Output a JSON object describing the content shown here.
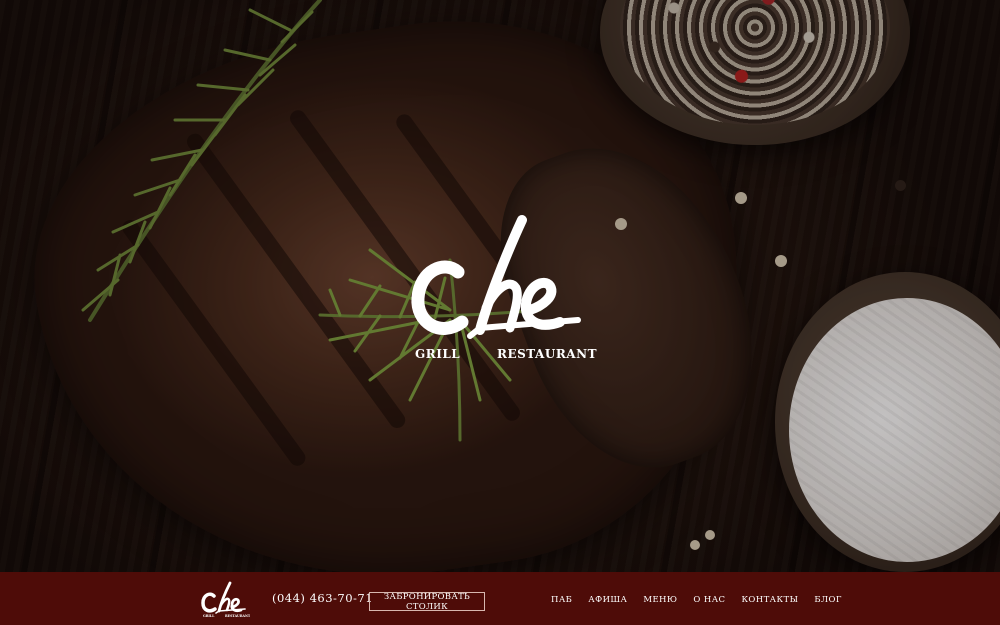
{
  "brand": {
    "logo_word": "Che",
    "sub_left": "GRILL",
    "sub_right": "RESTAURANT",
    "logo_color": "#ffffff"
  },
  "nav": {
    "phone": "(044) 463-70-71",
    "reserve_label": "ЗАБРОНИРОВАТЬ СТОЛИК",
    "items": [
      {
        "label": "ПАБ"
      },
      {
        "label": "АФИША"
      },
      {
        "label": "МЕНЮ"
      },
      {
        "label": "О НАС"
      },
      {
        "label": "КОНТАКТЫ"
      },
      {
        "label": "БЛОГ"
      }
    ],
    "background": "#4e0c08"
  },
  "hero": {
    "image": "grilled-steak-with-rosemary-pepper-and-salt"
  }
}
